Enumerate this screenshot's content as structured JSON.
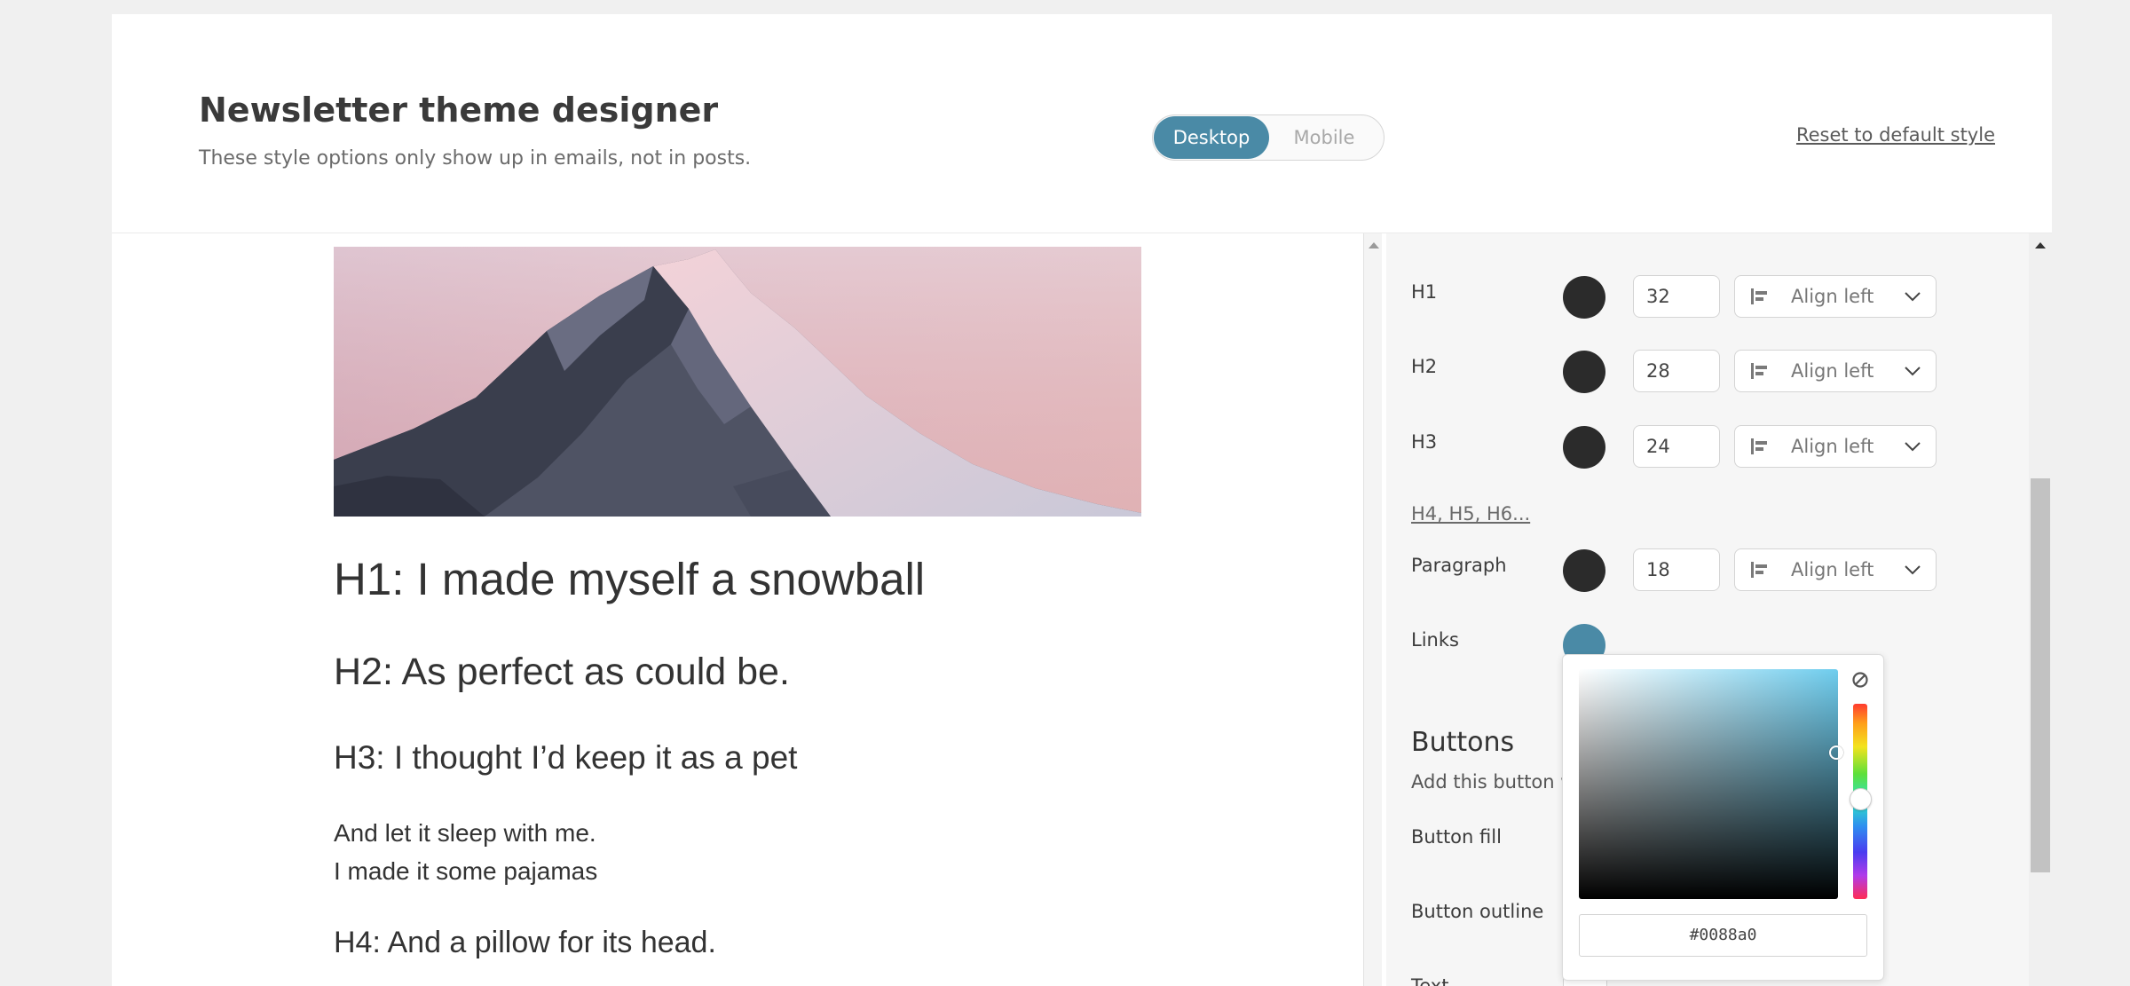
{
  "header": {
    "title": "Newsletter theme designer",
    "subtitle": "These style options only show up in emails, not in posts.",
    "view_toggle": {
      "desktop_label": "Desktop",
      "mobile_label": "Mobile",
      "selected": "Desktop"
    },
    "reset_label": "Reset to default style"
  },
  "preview": {
    "h1": "H1: I made myself a snowball",
    "h2": "H2: As perfect as could be.",
    "h3": "H3: I thought I’d keep it as a pet",
    "paragraph_lines": [
      "And let it sleep with me.",
      "I made it some pajamas"
    ],
    "h4": "H4: And a pillow for its head."
  },
  "styles": {
    "rows": [
      {
        "label": "H1",
        "color": "#2b2b2b",
        "size": "32",
        "align": "Align left"
      },
      {
        "label": "H2",
        "color": "#2b2b2b",
        "size": "28",
        "align": "Align left"
      },
      {
        "label": "H3",
        "color": "#2b2b2b",
        "size": "24",
        "align": "Align left"
      },
      {
        "label": "Paragraph",
        "color": "#2b2b2b",
        "size": "18",
        "align": "Align left"
      }
    ],
    "more_headings_link": "H4, H5, H6...",
    "links": {
      "label": "Links",
      "color": "#4a8aa6"
    }
  },
  "buttons": {
    "title": "Buttons",
    "description": "Add this button wl",
    "rows": [
      "Button fill",
      "Button outline",
      "Text"
    ]
  },
  "color_picker": {
    "hex_value": "#0088a0",
    "icons": [
      "no-color-icon"
    ]
  },
  "colors": {
    "accent": "#4a8aa6",
    "text": "#3c3c3c",
    "swatch_dark": "#2b2b2b"
  }
}
